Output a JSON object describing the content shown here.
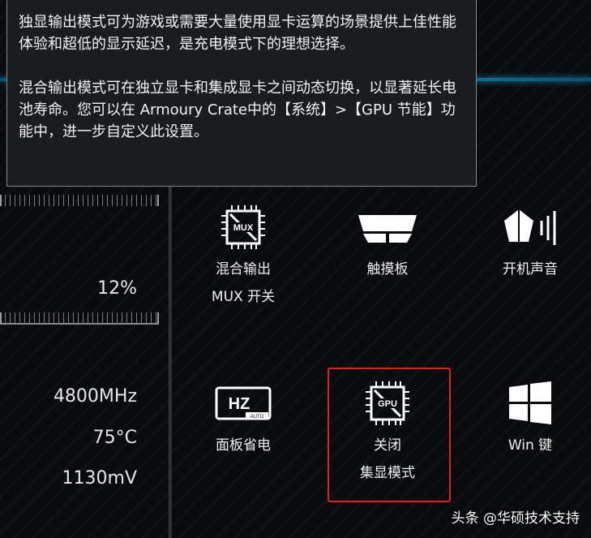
{
  "tooltip": {
    "paragraph1": "独显输出模式可为游戏或需要大量使用显卡运算的场景提供上佳性能体验和超低的显示延迟，是充电模式下的理想选择。",
    "paragraph2": "混合输出模式可在独立显卡和集成显卡之间动态切换，以显著延长电池寿命。您可以在 Armoury Crate中的【系统】>【GPU 节能】功能中，进一步自定义此设置。"
  },
  "left_panel": {
    "percent": "12%",
    "freq": "4800MHz",
    "temp": "75°C",
    "voltage": "1130mV"
  },
  "tiles": [
    {
      "icon": "mux-chip-icon",
      "line1": "混合输出",
      "line2": "MUX 开关"
    },
    {
      "icon": "touchpad-icon",
      "line1": "",
      "line2": "触摸板"
    },
    {
      "icon": "speaker-icon",
      "line1": "",
      "line2": "开机声音"
    },
    {
      "icon": "hz-auto-icon",
      "line1": "",
      "line2": "面板省电"
    },
    {
      "icon": "gpu-off-icon",
      "line1": "关闭",
      "line2": "集显模式"
    },
    {
      "icon": "windows-icon",
      "line1": "",
      "line2": "Win 键"
    }
  ],
  "colors": {
    "accent": "#1f94c9",
    "highlight": "#d9251d"
  },
  "watermark": "头条 @华硕技术支持"
}
